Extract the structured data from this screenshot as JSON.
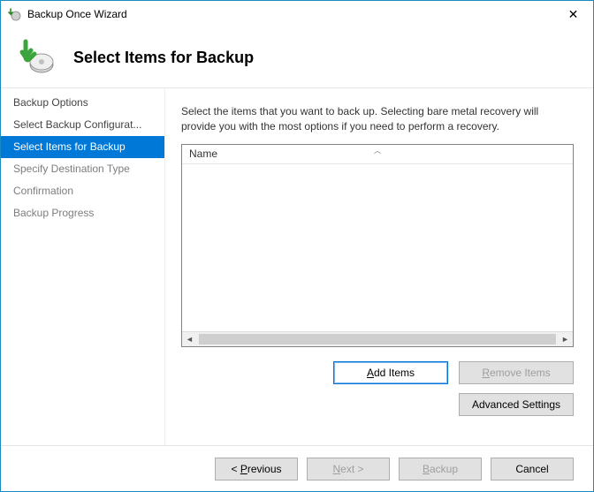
{
  "window": {
    "title": "Backup Once Wizard"
  },
  "header": {
    "title": "Select Items for Backup"
  },
  "sidebar": {
    "steps": [
      {
        "label": "Backup Options",
        "state": "done"
      },
      {
        "label": "Select Backup Configurat...",
        "state": "done"
      },
      {
        "label": "Select Items for Backup",
        "state": "active"
      },
      {
        "label": "Specify Destination Type",
        "state": "pending"
      },
      {
        "label": "Confirmation",
        "state": "pending"
      },
      {
        "label": "Backup Progress",
        "state": "pending"
      }
    ]
  },
  "main": {
    "instruction": "Select the items that you want to back up. Selecting bare metal recovery will provide you with the most options if you need to perform a recovery.",
    "list": {
      "column_name": "Name"
    },
    "buttons": {
      "add_items": "Add Items",
      "remove_items": "Remove Items",
      "advanced_settings": "Advanced Settings"
    }
  },
  "footer": {
    "previous": "Previous",
    "next": "Next >",
    "backup": "Backup",
    "cancel": "Cancel"
  }
}
